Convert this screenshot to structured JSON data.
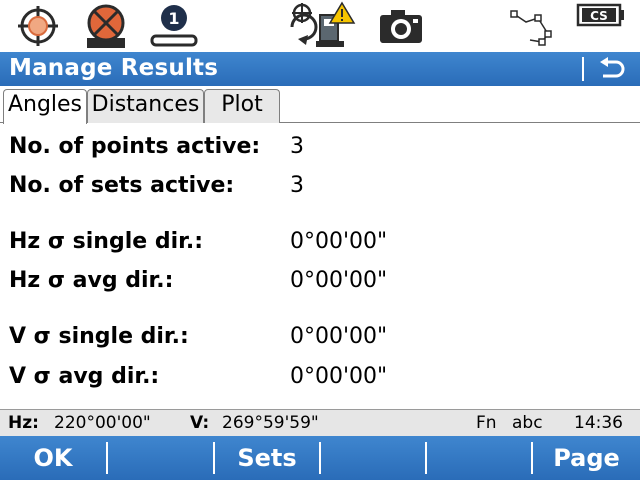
{
  "status_icons": [
    {
      "name": "crosshair-target-icon"
    },
    {
      "name": "prism-target-icon"
    },
    {
      "name": "face-one-icon",
      "label": "1"
    },
    {
      "name": "instrument-warning-icon"
    },
    {
      "name": "camera-icon"
    },
    {
      "name": "polygon-line-icon"
    },
    {
      "name": "battery-cs-icon",
      "label": "CS"
    }
  ],
  "header": {
    "title": "Manage Results"
  },
  "tabs": [
    {
      "label": "Angles",
      "active": true
    },
    {
      "label": "Distances",
      "active": false
    },
    {
      "label": "Plot",
      "active": false
    }
  ],
  "results": {
    "points_active": {
      "label": "No. of points active:",
      "value": "3"
    },
    "sets_active": {
      "label": "No. of sets active:",
      "value": "3"
    },
    "hz_single": {
      "label": "Hz σ single dir.:",
      "value": "0°00'00\""
    },
    "hz_avg": {
      "label": "Hz σ avg dir.:",
      "value": "0°00'00\""
    },
    "v_single": {
      "label": "V σ single dir.:",
      "value": "0°00'00\""
    },
    "v_avg": {
      "label": "V σ avg dir.:",
      "value": "0°00'00\""
    }
  },
  "info": {
    "hz_label": "Hz:",
    "hz_value": "220°00'00\"",
    "v_label": "V:",
    "v_value": "269°59'59\"",
    "fn": "Fn",
    "input_mode": "abc",
    "time": "14:36"
  },
  "softkeys": {
    "f1": "OK",
    "f2": "",
    "f3": "Sets",
    "f4": "",
    "f5": "",
    "f6": "Page"
  },
  "colors": {
    "bar_blue": "#2f74c0",
    "icon_orange": "#e0673a",
    "icon_dark": "#1f2f4a"
  }
}
